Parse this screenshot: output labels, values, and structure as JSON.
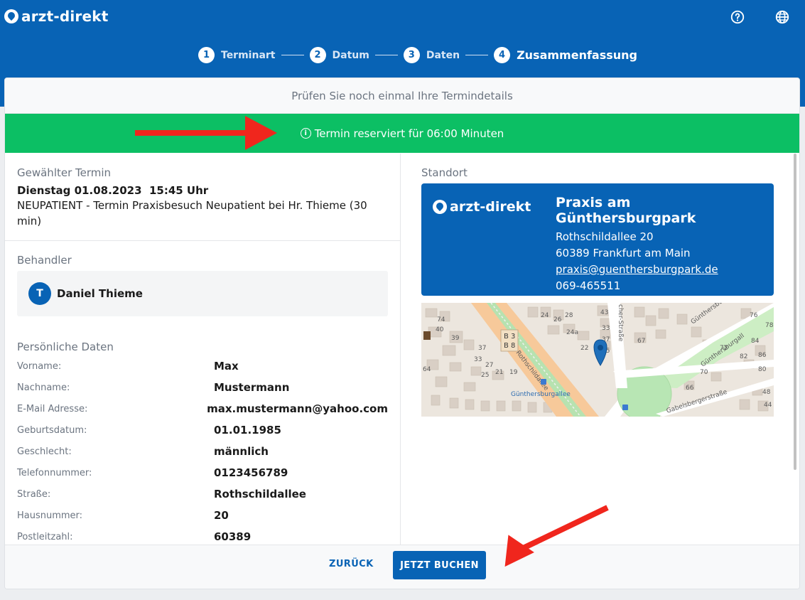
{
  "app": {
    "brand": "arzt-direkt"
  },
  "steps": [
    {
      "num": "1",
      "label": "Terminart"
    },
    {
      "num": "2",
      "label": "Datum"
    },
    {
      "num": "3",
      "label": "Daten"
    },
    {
      "num": "4",
      "label": "Zusammenfassung"
    }
  ],
  "card": {
    "heading": "Prüfen Sie noch einmal Ihre Termindetails",
    "reservation": "Termin reserviert für 06:00 Minuten"
  },
  "termin": {
    "title": "Gewählter Termin",
    "date": "Dienstag 01.08.2023  15:45 Uhr",
    "desc": "NEUPATIENT - Termin Praxisbesuch Neupatient bei Hr. Thieme (30 min)"
  },
  "behandler": {
    "title": "Behandler",
    "initial": "T",
    "name": "Daniel Thieme"
  },
  "personal": {
    "title": "Persönliche Daten",
    "rows": [
      {
        "label": "Vorname:",
        "value": "Max"
      },
      {
        "label": "Nachname:",
        "value": "Mustermann"
      },
      {
        "label": "E-Mail Adresse:",
        "value": "max.mustermann@yahoo.com"
      },
      {
        "label": "Geburtsdatum:",
        "value": "01.01.1985"
      },
      {
        "label": "Geschlecht:",
        "value": "männlich"
      },
      {
        "label": "Telefonnummer:",
        "value": "0123456789"
      },
      {
        "label": "Straße:",
        "value": "Rothschildallee"
      },
      {
        "label": "Hausnummer:",
        "value": "20"
      },
      {
        "label": "Postleitzahl:",
        "value": "60389"
      }
    ]
  },
  "standort": {
    "title": "Standort",
    "brand": "arzt-direkt",
    "name": "Praxis am Günthersburgpark",
    "street": "Rothschildallee 20",
    "city": "60389 Frankfurt am Main",
    "email": "praxis@guenthersburgpark.de",
    "phone": "069-465511"
  },
  "map": {
    "streets": [
      "Rothschildallee",
      "Günthersburgallee",
      "Gabelsbergerstraße",
      "Günthersburg",
      "Günthersburgall",
      "cher-Straße"
    ],
    "transit": [
      "B 3",
      "B 8"
    ],
    "house_numbers": [
      "24",
      "26",
      "28",
      "24a",
      "22",
      "37",
      "35",
      "33",
      "43",
      "39",
      "37",
      "33",
      "27",
      "25",
      "21",
      "19",
      "64",
      "74",
      "40",
      "67",
      "66",
      "70",
      "72",
      "76",
      "78",
      "84",
      "86",
      "82",
      "80",
      "48",
      "44"
    ]
  },
  "footer": {
    "back": "ZURÜCK",
    "book": "JETZT BUCHEN"
  },
  "colors": {
    "primary": "#0863b5",
    "success": "#0cbf64",
    "annotation": "#f0261d"
  }
}
